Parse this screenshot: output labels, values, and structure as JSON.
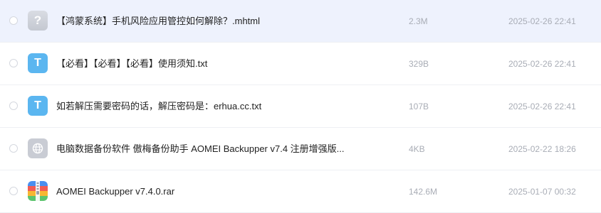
{
  "files": [
    {
      "name": "【鸿蒙系统】手机风险应用管控如何解除？.mhtml",
      "size": "2.3M",
      "date": "2025-02-26 22:41",
      "icon": "unknown-file-icon",
      "icon_glyph": "?",
      "selected": true
    },
    {
      "name": "【必看】【必看】【必看】使用须知.txt",
      "size": "329B",
      "date": "2025-02-26 22:41",
      "icon": "text-file-icon",
      "icon_glyph": "T",
      "selected": false
    },
    {
      "name": "如若解压需要密码的话，解压密码是：erhua.cc.txt",
      "size": "107B",
      "date": "2025-02-26 22:41",
      "icon": "text-file-icon",
      "icon_glyph": "T",
      "selected": false
    },
    {
      "name": "电脑数据备份软件 傲梅备份助手 AOMEI Backupper v7.4 注册增强版...",
      "size": "4KB",
      "date": "2025-02-22 18:26",
      "icon": "web-link-icon",
      "selected": false
    },
    {
      "name": "AOMEI Backupper v7.4.0.rar",
      "size": "142.6M",
      "date": "2025-01-07 00:32",
      "icon": "archive-file-icon",
      "selected": false
    }
  ],
  "colors": {
    "selected_row_bg": "#eef2fd",
    "txt_icon": "#5bb6f0",
    "muted_text": "#a9adb6"
  }
}
